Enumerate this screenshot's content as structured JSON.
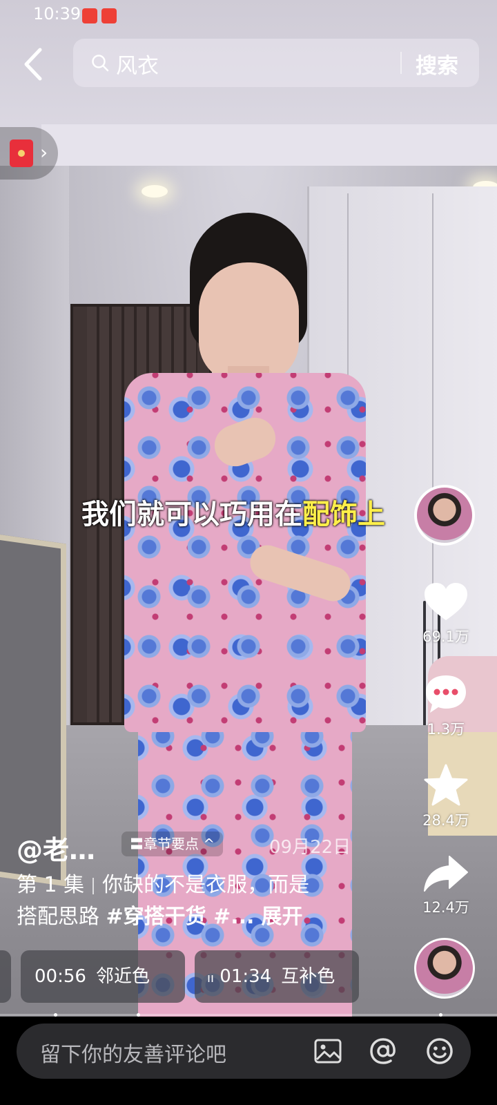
{
  "status_bar": {
    "time": "10:39"
  },
  "search": {
    "query": "风衣",
    "button_label": "搜索"
  },
  "video": {
    "subtitle_main": "我们就可以巧用在",
    "subtitle_highlight": "配饰上"
  },
  "actions": {
    "like_count": "69.1万",
    "comment_count": "1.3万",
    "favorite_count": "28.4万",
    "share_count": "12.4万"
  },
  "post": {
    "author": "@老…",
    "chapter_label": "〓章节要点 ^",
    "date": "09月22日",
    "desc_line1_a": "第 1 集",
    "desc_line1_b": "你缺的不是衣服，而是",
    "desc_line2_a": "搭配思路",
    "desc_line2_tags": "#穿搭干货 #...",
    "expand_label": "展开"
  },
  "chapters": [
    {
      "time": "00:56",
      "label": "邻近色"
    },
    {
      "prefix": "ıı",
      "time": "01:34",
      "label": "互补色"
    }
  ],
  "comment_bar": {
    "placeholder": "留下你的友善评论吧"
  },
  "colors": {
    "subtitle_highlight": "#ffef4a",
    "red_packet": "#e82f3b",
    "bottom_bar": "#000000"
  }
}
